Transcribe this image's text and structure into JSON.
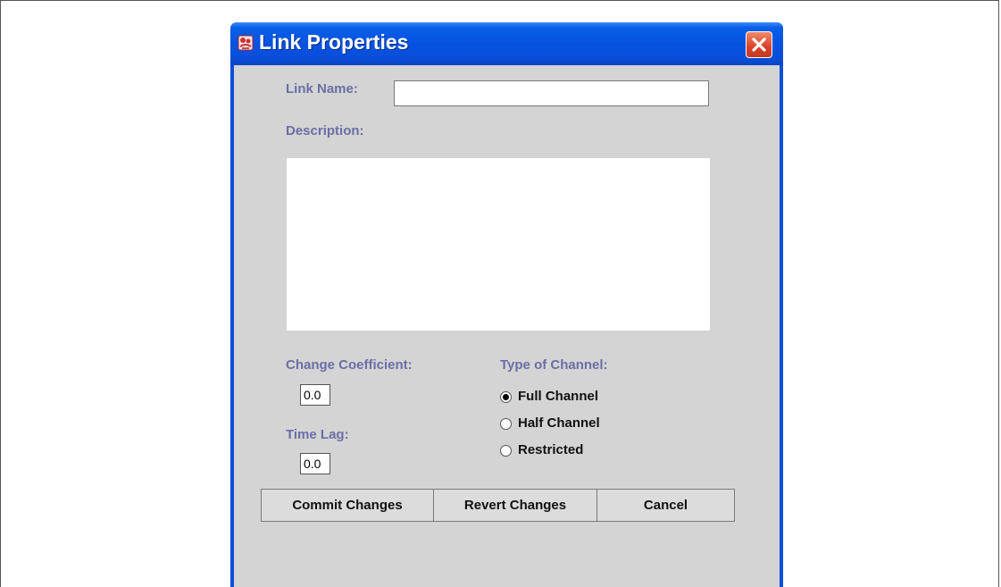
{
  "dialog": {
    "title": "Link Properties",
    "icon": "app-emblem-icon",
    "close_icon": "close-icon"
  },
  "form": {
    "link_name_label": "Link Name:",
    "link_name_value": "",
    "description_label": "Description:",
    "description_value": "",
    "change_coefficient_label": "Change Coefficient:",
    "change_coefficient_value": "0.0",
    "time_lag_label": "Time Lag:",
    "time_lag_value": "0.0",
    "channel_type_label": "Type of Channel:",
    "channel_options": [
      {
        "label": "Full Channel",
        "selected": true
      },
      {
        "label": "Half Channel",
        "selected": false
      },
      {
        "label": "Restricted",
        "selected": false
      }
    ]
  },
  "buttons": {
    "commit": "Commit Changes",
    "revert": "Revert Changes",
    "cancel": "Cancel"
  },
  "colors": {
    "titlebar": "#0653e0",
    "label": "#6b6ea6",
    "client_bg": "#d4d4d4",
    "close_button": "#d8432a"
  }
}
